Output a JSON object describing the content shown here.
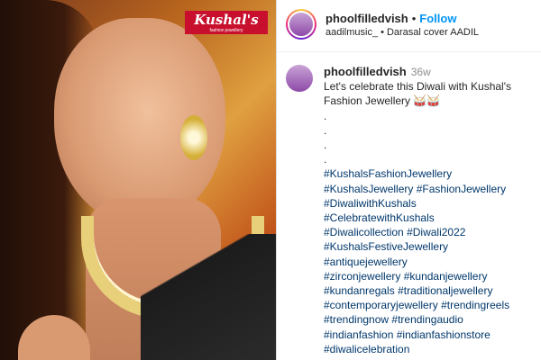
{
  "media": {
    "brand_logo": "Kushal's",
    "brand_tagline": "fashion jewellery"
  },
  "header": {
    "username": "phoolfilledvish",
    "follow_label": "Follow",
    "audio_user": "aadilmusic_",
    "audio_title": "Darasal cover AADIL"
  },
  "caption": {
    "username": "phoolfilledvish",
    "time": "36w",
    "text": "Let's celebrate this Diwali with Kushal's Fashion Jewellery 🥁🥁",
    "dots": [
      ".",
      ".",
      ".",
      "."
    ],
    "hashtag_lines": [
      [
        "#KushalsFashionJewellery"
      ],
      [
        "#KushalsJewellery",
        "#FashionJewellery"
      ],
      [
        "#DiwaliwithKushals"
      ],
      [
        "#CelebratewithKushals"
      ],
      [
        "#Diwalicollection",
        "#Diwali2022"
      ],
      [
        "#KushalsFestiveJewellery"
      ],
      [
        "#antiquejewellery"
      ],
      [
        "#zirconjewellery",
        "#kundanjewellery"
      ],
      [
        "#kundanregals",
        "#traditionaljewellery"
      ],
      [
        "#contemporaryjewellery",
        "#trendingreels"
      ],
      [
        "#trendingnow",
        "#trendingaudio"
      ],
      [
        "#indianfashion",
        "#indianfashionstore"
      ],
      [
        "#diwalicelebration"
      ]
    ]
  }
}
